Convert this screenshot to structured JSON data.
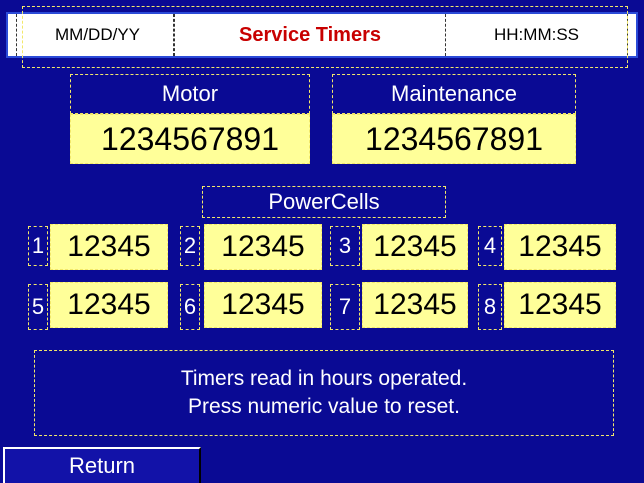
{
  "header": {
    "date_format": "MM/DD/YY",
    "title": "Service Timers",
    "time_format": "HH:MM:SS"
  },
  "timers": {
    "motor": {
      "label": "Motor",
      "value": "1234567891"
    },
    "maintenance": {
      "label": "Maintenance",
      "value": "1234567891"
    }
  },
  "powercells": {
    "label": "PowerCells",
    "cells": [
      {
        "number": "1",
        "value": "12345"
      },
      {
        "number": "2",
        "value": "12345"
      },
      {
        "number": "3",
        "value": "12345"
      },
      {
        "number": "4",
        "value": "12345"
      },
      {
        "number": "5",
        "value": "12345"
      },
      {
        "number": "6",
        "value": "12345"
      },
      {
        "number": "7",
        "value": "12345"
      },
      {
        "number": "8",
        "value": "12345"
      }
    ]
  },
  "info": {
    "line1": "Timers read in hours operated.",
    "line2": "Press numeric value to reset."
  },
  "footer": {
    "return_label": "Return"
  },
  "colors": {
    "background": "#0A0A94",
    "value_fill": "#FFFF99",
    "title_red": "#C80000"
  }
}
